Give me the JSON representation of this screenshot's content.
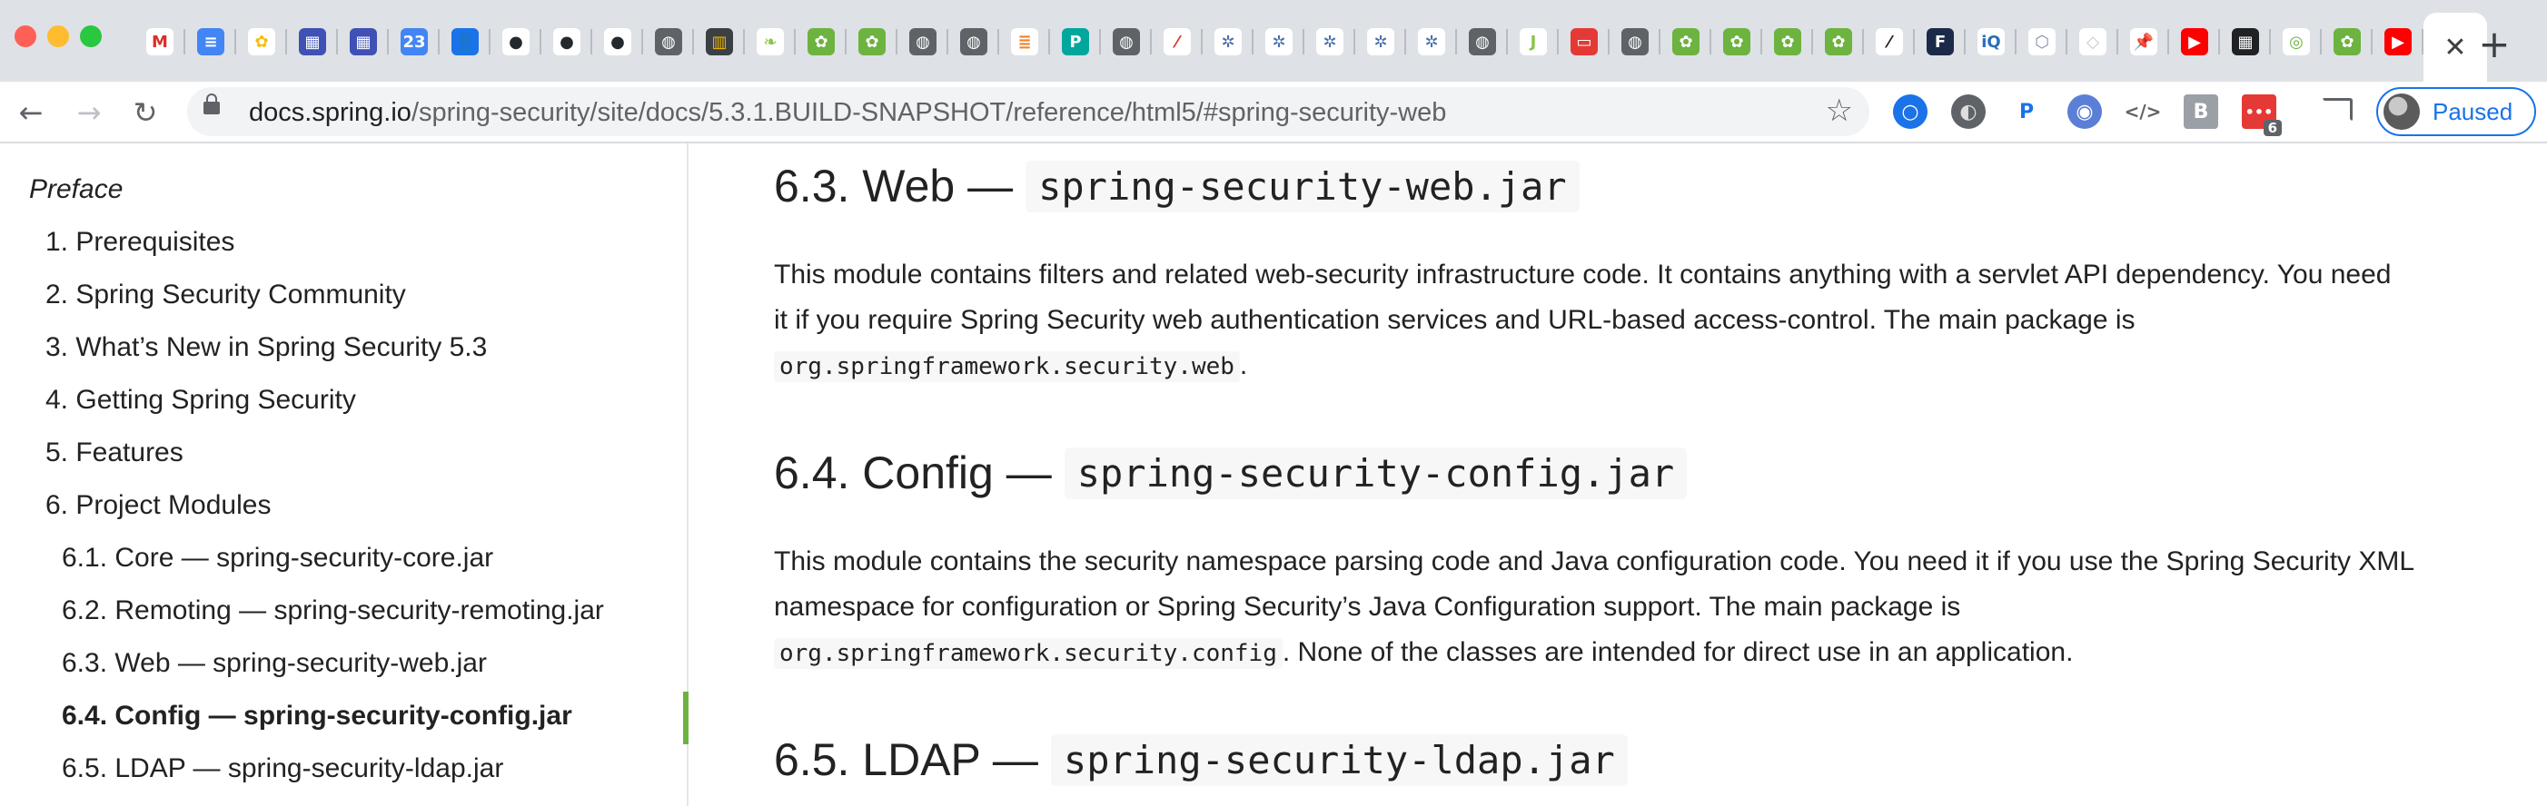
{
  "browser": {
    "favicons": [
      {
        "icon": "gmail-icon",
        "glyph": "M",
        "bg": "#ffffff",
        "fg": "#d93025"
      },
      {
        "icon": "google-docs-icon",
        "glyph": "≡",
        "bg": "#4285f4",
        "fg": "#ffffff"
      },
      {
        "icon": "google-photos-icon",
        "glyph": "✿",
        "bg": "#ffffff",
        "fg": "#fbbc04"
      },
      {
        "icon": "calendar-grid-icon",
        "glyph": "▦",
        "bg": "#3f51b5",
        "fg": "#ffffff"
      },
      {
        "icon": "calendar-grid-icon",
        "glyph": "▦",
        "bg": "#3f51b5",
        "fg": "#ffffff"
      },
      {
        "icon": "google-calendar-icon",
        "glyph": "23",
        "bg": "#4285f4",
        "fg": "#ffffff"
      },
      {
        "icon": "google-contacts-icon",
        "glyph": "👤",
        "bg": "#1a73e8",
        "fg": "#ffffff"
      },
      {
        "icon": "github-icon",
        "glyph": "●",
        "bg": "#ffffff",
        "fg": "#24292e"
      },
      {
        "icon": "github-icon",
        "glyph": "●",
        "bg": "#ffffff",
        "fg": "#24292e"
      },
      {
        "icon": "github-icon",
        "glyph": "●",
        "bg": "#ffffff",
        "fg": "#24292e"
      },
      {
        "icon": "globe-icon",
        "glyph": "◍",
        "bg": "#5f6368",
        "fg": "#ffffff"
      },
      {
        "icon": "stitch-icon",
        "glyph": "▥",
        "bg": "#3c4043",
        "fg": "#f5b400"
      },
      {
        "icon": "leaf-icon",
        "glyph": "❧",
        "bg": "#ffffff",
        "fg": "#8bc34a"
      },
      {
        "icon": "spring-icon",
        "glyph": "✿",
        "bg": "#6db33f",
        "fg": "#ffffff"
      },
      {
        "icon": "spring-icon",
        "glyph": "✿",
        "bg": "#6db33f",
        "fg": "#ffffff"
      },
      {
        "icon": "globe-icon",
        "glyph": "◍",
        "bg": "#5f6368",
        "fg": "#ffffff"
      },
      {
        "icon": "globe-icon",
        "glyph": "◍",
        "bg": "#5f6368",
        "fg": "#ffffff"
      },
      {
        "icon": "stackoverflow-icon",
        "glyph": "≣",
        "bg": "#ffffff",
        "fg": "#f48024"
      },
      {
        "icon": "pivotal-icon",
        "glyph": "P",
        "bg": "#00a79d",
        "fg": "#ffffff"
      },
      {
        "icon": "globe-icon",
        "glyph": "◍",
        "bg": "#5f6368",
        "fg": "#ffffff"
      },
      {
        "icon": "feather-icon",
        "glyph": "⁄",
        "bg": "#ffffff",
        "fg": "#d63a2f"
      },
      {
        "icon": "xray-icon",
        "glyph": "✲",
        "bg": "#ffffff",
        "fg": "#4a6ea9"
      },
      {
        "icon": "xray-icon",
        "glyph": "✲",
        "bg": "#ffffff",
        "fg": "#4a6ea9"
      },
      {
        "icon": "xray-icon",
        "glyph": "✲",
        "bg": "#ffffff",
        "fg": "#4a6ea9"
      },
      {
        "icon": "xray-icon",
        "glyph": "✲",
        "bg": "#ffffff",
        "fg": "#4a6ea9"
      },
      {
        "icon": "xray-icon",
        "glyph": "✲",
        "bg": "#ffffff",
        "fg": "#4a6ea9"
      },
      {
        "icon": "globe-icon",
        "glyph": "◍",
        "bg": "#5f6368",
        "fg": "#ffffff"
      },
      {
        "icon": "j-icon",
        "glyph": "J",
        "bg": "#ffffff",
        "fg": "#8bc34a"
      },
      {
        "icon": "red-square-icon",
        "glyph": "▭",
        "bg": "#e53935",
        "fg": "#ffffff"
      },
      {
        "icon": "globe-icon",
        "glyph": "◍",
        "bg": "#5f6368",
        "fg": "#ffffff"
      },
      {
        "icon": "spring-icon",
        "glyph": "✿",
        "bg": "#6db33f",
        "fg": "#ffffff"
      },
      {
        "icon": "spring-icon",
        "glyph": "✿",
        "bg": "#6db33f",
        "fg": "#ffffff"
      },
      {
        "icon": "spring-icon",
        "glyph": "✿",
        "bg": "#6db33f",
        "fg": "#ffffff"
      },
      {
        "icon": "spring-icon",
        "glyph": "✿",
        "bg": "#6db33f",
        "fg": "#ffffff"
      },
      {
        "icon": "slash-icon",
        "glyph": "⁄",
        "bg": "#ffffff",
        "fg": "#202124"
      },
      {
        "icon": "f-icon",
        "glyph": "F",
        "bg": "#1c2a4a",
        "fg": "#ffffff"
      },
      {
        "icon": "infoq-icon",
        "glyph": "iQ",
        "bg": "#ffffff",
        "fg": "#2a6ebb"
      },
      {
        "icon": "hexagon-icon",
        "glyph": "⬡",
        "bg": "#ffffff",
        "fg": "#7b8bb0"
      },
      {
        "icon": "diamond-icon",
        "glyph": "◇",
        "bg": "#ffffff",
        "fg": "#c7c7c7"
      },
      {
        "icon": "pin-icon",
        "glyph": "📌",
        "bg": "#ffffff",
        "fg": "#202124"
      },
      {
        "icon": "youtube-icon",
        "glyph": "▶",
        "bg": "#ff0000",
        "fg": "#ffffff"
      },
      {
        "icon": "grid-icon",
        "glyph": "▦",
        "bg": "#202124",
        "fg": "#ffffff"
      },
      {
        "icon": "target-icon",
        "glyph": "◎",
        "bg": "#ffffff",
        "fg": "#6db33f"
      },
      {
        "icon": "spring-icon",
        "glyph": "✿",
        "bg": "#6db33f",
        "fg": "#ffffff"
      },
      {
        "icon": "youtube-icon",
        "glyph": "▶",
        "bg": "#ff0000",
        "fg": "#ffffff"
      }
    ],
    "active_tab_close": "✕",
    "new_tab": "+",
    "nav": {
      "back": "←",
      "forward": "→",
      "reload": "↻"
    },
    "url_host": "docs.spring.io",
    "url_path": "/spring-security/site/docs/5.3.1.BUILD-SNAPSHOT/reference/html5/#spring-security-web",
    "bookmark_star": "☆",
    "extension_badge": "6",
    "profile_label": "Paused"
  },
  "toc": {
    "preface": "Preface",
    "items": [
      "1. Prerequisites",
      "2. Spring Security Community",
      "3. What’s New in Spring Security 5.3",
      "4. Getting Spring Security",
      "5. Features",
      "6. Project Modules"
    ],
    "subitems": [
      "6.1. Core — spring-security-core.jar",
      "6.2. Remoting — spring-security-remoting.jar",
      "6.3. Web — spring-security-web.jar",
      "6.4. Config — spring-security-config.jar",
      "6.5. LDAP — spring-security-ldap.jar"
    ]
  },
  "sections": [
    {
      "title": "6.3. Web —",
      "jar": "spring-security-web.jar",
      "line1": "This module contains filters and related web-security infrastructure code. It contains anything with a servlet API dependency. You need",
      "line2": "it if you require Spring Security web authentication services and URL-based access-control. The main package is",
      "code": "org.springframework.security.web",
      "tail": "."
    },
    {
      "title": "6.4. Config —",
      "jar": "spring-security-config.jar",
      "line1": "This module contains the security namespace parsing code and Java configuration code. You need it if you use the Spring Security XML",
      "line2": "namespace for configuration or Spring Security’s Java Configuration support. The main package is",
      "code": "org.springframework.security.config",
      "tail": ". None of the classes are intended for direct use in an application."
    },
    {
      "title": "6.5. LDAP —",
      "jar": "spring-security-ldap.jar"
    }
  ],
  "colors": {
    "active_marker": "#6db33f",
    "link_blue": "#1a73e8"
  }
}
